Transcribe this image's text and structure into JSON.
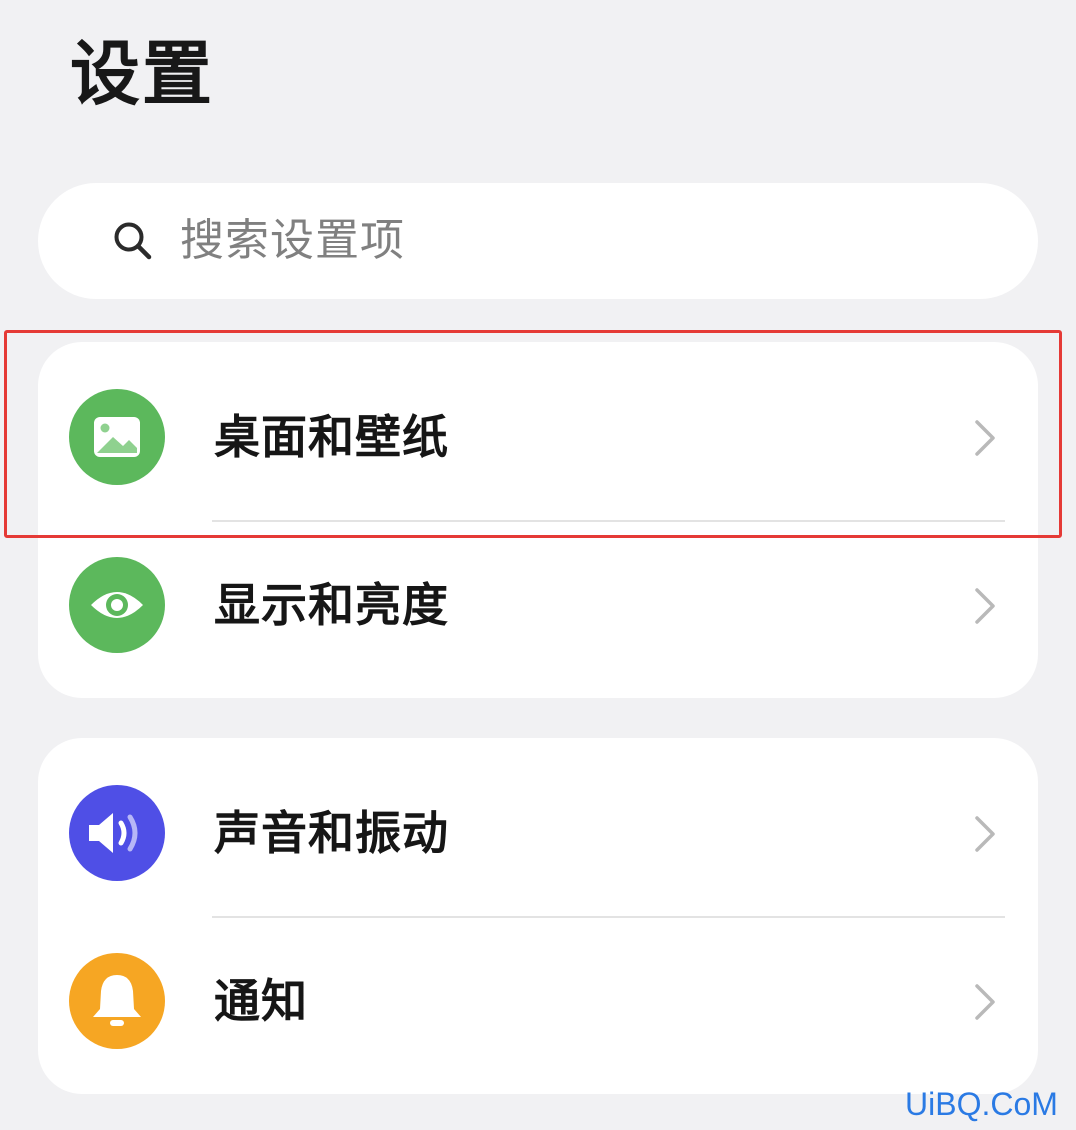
{
  "header": {
    "title": "设置"
  },
  "search": {
    "placeholder": "搜索设置项",
    "icon": "search-icon"
  },
  "groups": [
    {
      "items": [
        {
          "label": "桌面和壁纸",
          "icon": "wallpaper-icon",
          "icon_color": "#5cb85c",
          "highlighted": true
        },
        {
          "label": "显示和亮度",
          "icon": "eye-icon",
          "icon_color": "#5cb85c",
          "highlighted": false
        }
      ]
    },
    {
      "items": [
        {
          "label": "声音和振动",
          "icon": "speaker-icon",
          "icon_color": "#4f4fe6",
          "highlighted": false
        },
        {
          "label": "通知",
          "icon": "bell-icon",
          "icon_color": "#f6a623",
          "highlighted": false
        }
      ]
    }
  ],
  "watermark": "UiBQ.CoM",
  "colors": {
    "background": "#f1f1f3",
    "card": "#ffffff",
    "highlight_border": "#e53a36",
    "watermark": "#2a7ae4"
  }
}
